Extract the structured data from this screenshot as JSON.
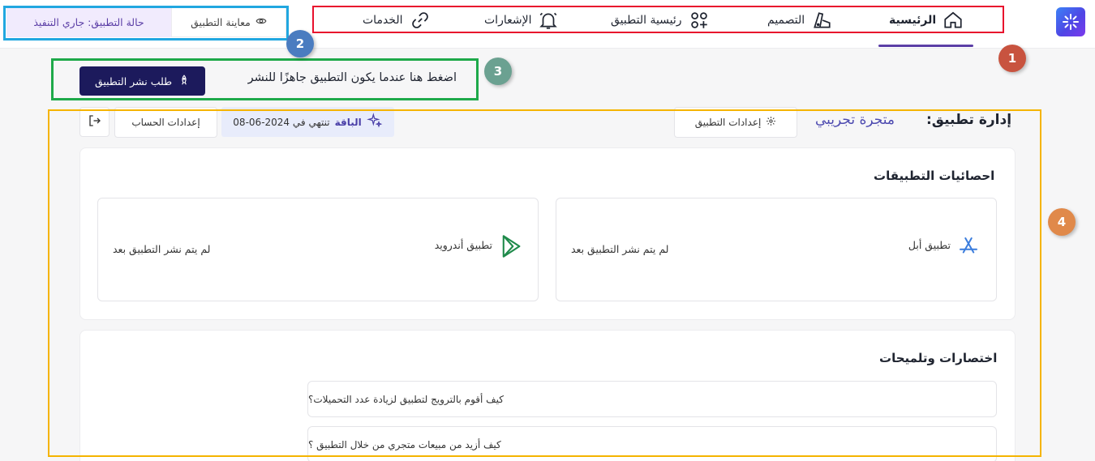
{
  "nav": {
    "items": [
      {
        "label": "الرئيسية",
        "icon": "home-icon",
        "active": true
      },
      {
        "label": "التصميم",
        "icon": "design-icon",
        "active": false
      },
      {
        "label": "رئيسية التطبيق",
        "icon": "app-home-icon",
        "active": false
      },
      {
        "label": "الإشعارات",
        "icon": "bell-icon",
        "active": false
      },
      {
        "label": "الخدمات",
        "icon": "link-icon",
        "active": false
      }
    ]
  },
  "preview_button": {
    "label": "معاينة التطبيق",
    "icon": "eye-icon"
  },
  "app_status": {
    "label": "حالة التطبيق: جاري التنفيذ"
  },
  "annotations": [
    "1",
    "2",
    "3",
    "4"
  ],
  "publish": {
    "text": "اضغط هنا عندما يكون التطبيق جاهزًا للنشر",
    "button_label": "طلب نشر التطبيق",
    "button_icon": "rocket-icon"
  },
  "header": {
    "title": "إدارة تطبيق:",
    "store_name": "متجرة تجريبي",
    "app_settings_label": "إعدادات التطبيق",
    "plan_bold": "الباقة",
    "plan_text": "تنتهي في 2024-06-08",
    "account_settings_label": "إعدادات الحساب"
  },
  "stats": {
    "title": "احصائيات التطبيقات",
    "apple": {
      "name": "تطبيق أبل",
      "status": "لم يتم نشر التطبيق بعد"
    },
    "android": {
      "name": "تطبيق أندرويد",
      "status": "لم يتم نشر التطبيق بعد"
    }
  },
  "tips": {
    "title": "اختصارات وتلميحات",
    "items": [
      "كيف أقوم بالترويج لتطبيق لزيادة عدد التحميلات؟",
      "كيف أزيد من مبيعات متجري من خلال التطبيق ؟"
    ]
  },
  "colors": {
    "primary": "#1c1a5c",
    "accent": "#5b3ea6",
    "annotation_red": "#e8112d",
    "annotation_blue": "#21a7e0",
    "annotation_green": "#1ea94a",
    "annotation_yellow": "#f5b400"
  }
}
